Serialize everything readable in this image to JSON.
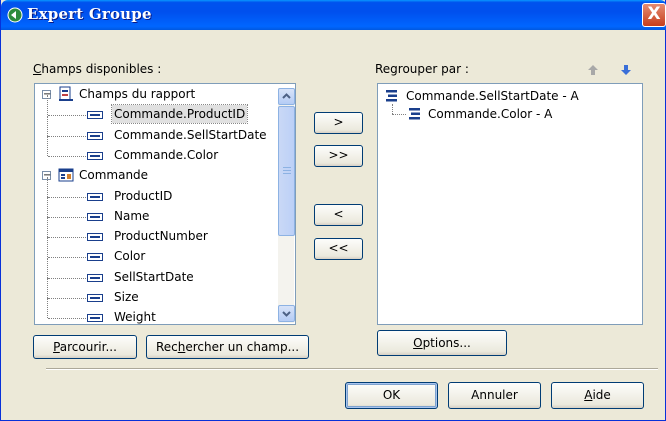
{
  "window": {
    "title": "Expert Groupe",
    "close_label": "X"
  },
  "available": {
    "label_hotkey": "C",
    "label_rest": "hamps disponibles :",
    "tree": [
      {
        "label": "Champs du rapport",
        "level": 0,
        "kind": "group",
        "icon": "report-icon"
      },
      {
        "label": "Commande.ProductID",
        "level": 1,
        "kind": "field",
        "selected": true
      },
      {
        "label": "Commande.SellStartDate",
        "level": 1,
        "kind": "field"
      },
      {
        "label": "Commande.Color",
        "level": 1,
        "kind": "field"
      },
      {
        "label": "Commande",
        "level": 0,
        "kind": "group",
        "icon": "table-icon"
      },
      {
        "label": "ProductID",
        "level": 1,
        "kind": "field"
      },
      {
        "label": "Name",
        "level": 1,
        "kind": "field"
      },
      {
        "label": "ProductNumber",
        "level": 1,
        "kind": "field"
      },
      {
        "label": "Color",
        "level": 1,
        "kind": "field"
      },
      {
        "label": "SellStartDate",
        "level": 1,
        "kind": "field"
      },
      {
        "label": "Size",
        "level": 1,
        "kind": "field"
      },
      {
        "label": "Weight",
        "level": 1,
        "kind": "field"
      }
    ],
    "expander_symbol": "−"
  },
  "transfer": {
    "add": ">",
    "add_all": ">>",
    "remove": "<",
    "remove_all": "<<"
  },
  "grouping": {
    "label": "Regrouper par :",
    "items": [
      {
        "label": "Commande.SellStartDate - A",
        "level": 0
      },
      {
        "label": "Commande.Color - A",
        "level": 1
      }
    ]
  },
  "buttons": {
    "browse_hotkey": "P",
    "browse_rest": "arcourir...",
    "find_pre": "Rec",
    "find_hotkey": "h",
    "find_rest": "ercher un champ...",
    "options_hotkey": "O",
    "options_rest": "ptions...",
    "ok": "OK",
    "cancel": "Annuler",
    "help_hotkey": "A",
    "help_rest": "ide"
  },
  "colors": {
    "title_bar": "#0053ee",
    "dialog_bg": "#ece9d8",
    "arrow_up_disabled": "#a0a0a0",
    "arrow_down": "#3a6fd8"
  }
}
